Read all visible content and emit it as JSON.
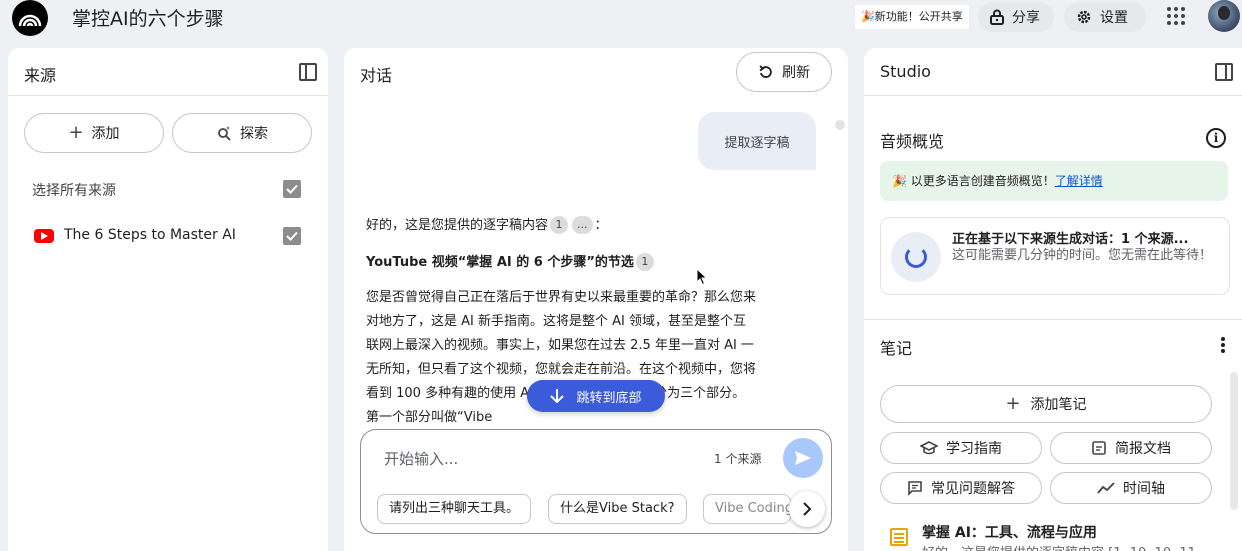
{
  "header": {
    "title": "掌控AI的六个步骤",
    "feature_badge": "🎉新功能！公开共享",
    "share_label": "分享",
    "settings_label": "设置"
  },
  "sources_panel": {
    "title": "来源",
    "add_label": "添加",
    "explore_label": "探索",
    "select_all_label": "选择所有来源",
    "items": [
      {
        "name": "The 6 Steps to Master AI",
        "icon": "youtube-icon",
        "checked": true
      }
    ]
  },
  "chat_panel": {
    "title": "对话",
    "refresh_label": "刷新",
    "user_message": "提取逐字稿",
    "intro_text": "好的，这是您提供的逐字稿内容",
    "intro_cite": "1",
    "intro_more": "...",
    "intro_colon": "：",
    "heading": "YouTube 视频“掌握 AI 的 6 个步骤”的节选",
    "heading_cite": "1",
    "body": "您是否曾觉得自己正在落后于世界有史以来最重要的革命？那么您来对地方了，这是 AI 新手指南。这将是整个 AI 领域，甚至是整个互联网上最深入的视频。事实上，如果您在过去 2.5 年里一直对 AI 一无所知，但只看了这个视频，您就会走在前沿。在这个视频中，您将看到 100 多种有趣的使用 AI 的方法。这个视频将分为三个部分。第一个部分叫做“Vibe",
    "jump_label": "跳转到底部",
    "composer_placeholder": "开始输入...",
    "source_count": "1 个来源",
    "suggestions": [
      "请列出三种聊天工具。",
      "什么是Vibe Stack?",
      "Vibe Coding"
    ]
  },
  "studio_panel": {
    "title": "Studio",
    "audio_title": "音频概览",
    "promo_text": "🎉 以更多语言创建音频概览！",
    "promo_link": "了解详情",
    "gen_title": "正在基于以下来源生成对话：1 个来源...",
    "gen_sub": "这可能需要几分钟的时间。您无需在此等待！",
    "notes_title": "笔记",
    "add_note_label": "添加笔记",
    "chips": {
      "study": "学习指南",
      "brief": "简报文档",
      "faq": "常见问题解答",
      "timeline": "时间轴"
    },
    "note": {
      "title": "掌握 AI：工具、流程与应用",
      "snippet": "好的，这是您提供的逐字稿内容 [1, 10, 10, 11"
    }
  },
  "colors": {
    "accent": "#3b5bdb",
    "send_button": "#a8c7fa",
    "promo_bg": "#e6f4ea",
    "user_bubble": "#e9eef6",
    "youtube_red": "#ff0000"
  }
}
